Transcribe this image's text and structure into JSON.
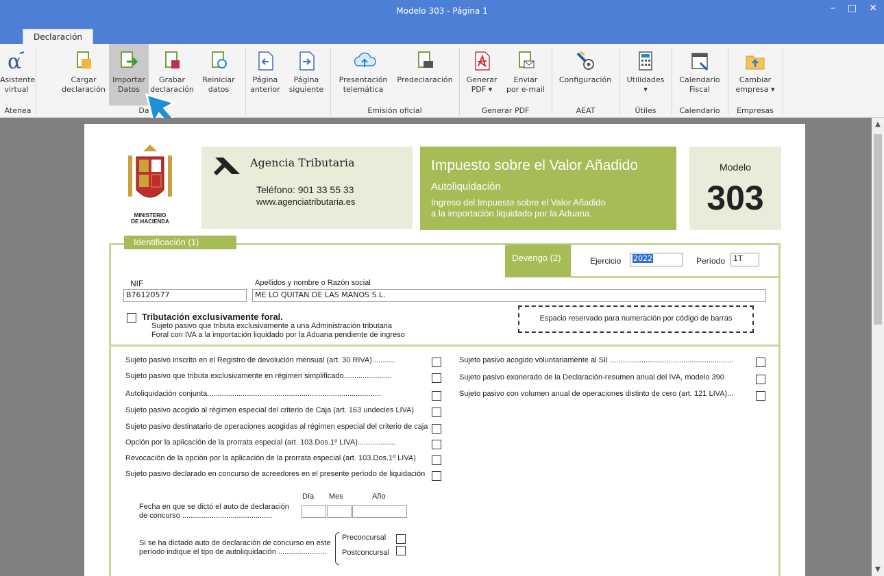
{
  "window": {
    "title": "Modelo 303 - Página 1",
    "controls": [
      "–",
      "□",
      "✕"
    ]
  },
  "tab": {
    "label": "Declaración"
  },
  "ribbon": {
    "buttons": [
      {
        "l1": "Asistente",
        "l2": "virtual"
      },
      {
        "l1": "Cargar",
        "l2": "declaración"
      },
      {
        "l1": "Importar",
        "l2": "Datos"
      },
      {
        "l1": "Grabar",
        "l2": "declaración"
      },
      {
        "l1": "Reiniciar",
        "l2": "datos"
      },
      {
        "l1": "Página",
        "l2": "anterior"
      },
      {
        "l1": "Página",
        "l2": "siguiente"
      },
      {
        "l1": "Presentación",
        "l2": "telemática"
      },
      {
        "l1": "Predeclaración",
        "l2": ""
      },
      {
        "l1": "Generar",
        "l2": "PDF ▾"
      },
      {
        "l1": "Enviar",
        "l2": "por e-mail"
      },
      {
        "l1": "Configuración",
        "l2": ""
      },
      {
        "l1": "Utilidades",
        "l2": "▾"
      },
      {
        "l1": "Calendario",
        "l2": "Fiscal"
      },
      {
        "l1": "Cambiar",
        "l2": "empresa ▾"
      }
    ],
    "groups": [
      "Atenea",
      "Da",
      "Emisión oficial",
      "Generar PDF",
      "AEAT",
      "Útiles",
      "Calendario",
      "Empresas"
    ]
  },
  "header": {
    "ministerio": "MINISTERIO\nDE HACIENDA",
    "agencia": "Agencia Tributaria",
    "telefono": "Teléfono: 901 33 55 33",
    "web": "www.agenciatributaria.es",
    "impuesto": "Impuesto sobre el Valor Añadido",
    "autoliq": "Autoliquidación",
    "ingreso1": "Ingreso del Impuesto sobre el Valor Añadido",
    "ingreso2": "a la importación liquidado por la Aduana.",
    "modelo_label": "Modelo",
    "modelo_num": "303"
  },
  "ident": {
    "section": "Identificación (1)",
    "devengo": "Devengo (2)",
    "ejercicio_label": "Ejercicio",
    "ejercicio": "2022",
    "periodo_label": "Período",
    "periodo": "1T",
    "nif_label": "NIF",
    "nif": "B76120577",
    "razon_label": "Apellidos y nombre o Razón social",
    "razon": "ME LO QUITAN DE LAS MANOS S.L.",
    "foral_title": "Tributación exclusivamente foral.",
    "foral_l1": "Sujeto pasivo que tributa exclusivamente a una Administración tributaria",
    "foral_l2": "Foral con IVA a la importación liquidado por la Aduana pendiente de ingreso",
    "barcode": "Espacio reservado para numeración por código de barras"
  },
  "left_checks": [
    "Sujeto pasivo inscrito en el Registro de devolución mensual (art. 30 RIVA)...........",
    "Sujeto pasivo que tributa exclusivamente en régimen simplificado.......................",
    "Autoliquidación conjunta...................................................................................",
    "Sujeto pasivo acogido al régimen especial del criterio de Caja (art. 163 undecies LIVA)",
    "Sujeto pasivo destinatario de operaciones acogidas al régimen especial del criterio de caja",
    "Opción por la aplicación de la prorrata especial (art. 103.Dos.1º LIVA)..................",
    "Revocación de la opción por la aplicación de la prorrata especial (art. 103.Dos.1º LIVA)",
    "Sujeto pasivo declarado en concurso de acreedores en el presente período de liquidación"
  ],
  "right_checks": [
    "Sujeto pasivo acogido voluntariamente al SII ...........................................................",
    "Sujeto pasivo exonerado de la Declaración-resumen anual del IVA, modelo 390",
    "Sujeto pasivo con volumen anual de operaciones distinto de cero (art. 121 LIVA)..."
  ],
  "concurso": {
    "dia": "Día",
    "mes": "Mes",
    "anio": "Año",
    "fecha_l1": "Fecha en que se dictó el auto de declaración",
    "fecha_l2": "de concurso ...........................................",
    "tipo_l1": "Si se ha dictado auto de declaración de concurso en este",
    "tipo_l2": "período indique el tipo de autoliquidación .......................",
    "pre": "Preconcursal",
    "post": "Postconcursal"
  },
  "colors": {
    "titlebar": "#4e7fd6",
    "green": "#a6bc56",
    "light_green": "#e9ecd9",
    "cursor": "#1f8fd6"
  }
}
